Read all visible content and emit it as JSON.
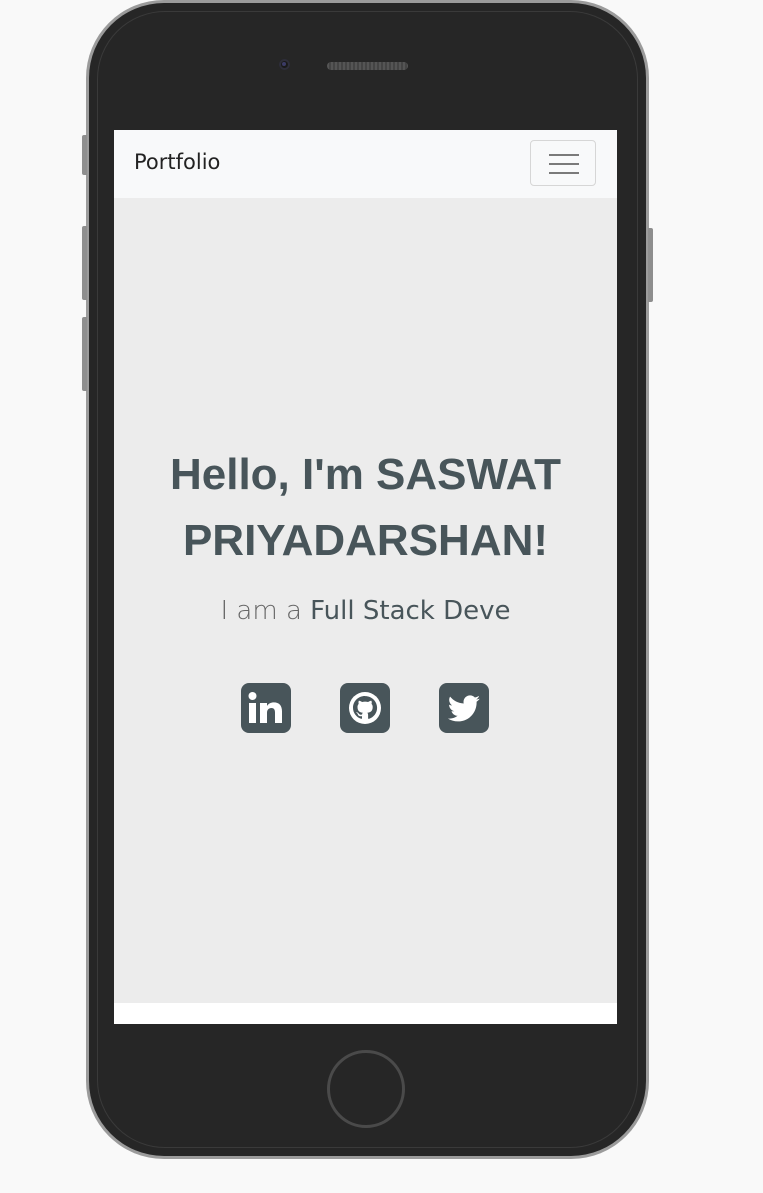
{
  "navbar": {
    "brand": "Portfolio",
    "toggler_icon": "hamburger-icon"
  },
  "hero": {
    "title_line1": "Hello, I'm SASWAT",
    "title_line2": "PRIYADARSHAN!",
    "subtitle_prefix": "I am a",
    "subtitle_role": "Full Stack Deve"
  },
  "socials": [
    {
      "icon": "linkedin-icon"
    },
    {
      "icon": "github-icon"
    },
    {
      "icon": "twitter-icon"
    }
  ],
  "colors": {
    "accent": "#48555a",
    "hero_background": "#ececec",
    "navbar_background": "#f8f9fa",
    "device_body": "#262626"
  }
}
